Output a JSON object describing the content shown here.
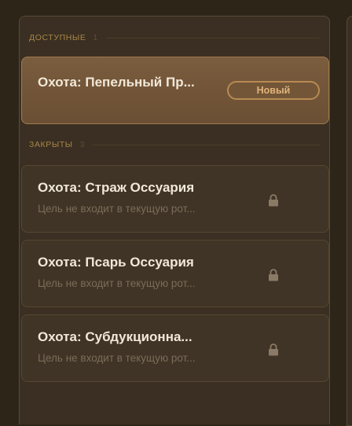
{
  "sections": {
    "available": {
      "header": "ДОСТУПНЫЕ",
      "count": "1",
      "items": [
        {
          "title": "Охота: Пепельный Пр...",
          "badge": "Новый"
        }
      ]
    },
    "locked": {
      "header": "ЗАКРЫТЫ",
      "count": "3",
      "items": [
        {
          "title": "Охота: Страж Оссуария",
          "subtitle": "Цель не входит в текущую рот...",
          "icon": "lock-icon"
        },
        {
          "title": "Охота: Псарь Оссуария",
          "subtitle": "Цель не входит в текущую рот...",
          "icon": "lock-icon"
        },
        {
          "title": "Охота: Субдукционна...",
          "subtitle": "Цель не входит в текущую рот...",
          "icon": "lock-icon"
        }
      ]
    }
  },
  "colors": {
    "background": "#2e2519",
    "panel": "#3a2f22",
    "accent": "#a88648",
    "available_card": "#7a5c3e",
    "badge_border": "#b88a52",
    "title_text": "#f2e8d8",
    "subtitle_text": "#7c6c58"
  }
}
